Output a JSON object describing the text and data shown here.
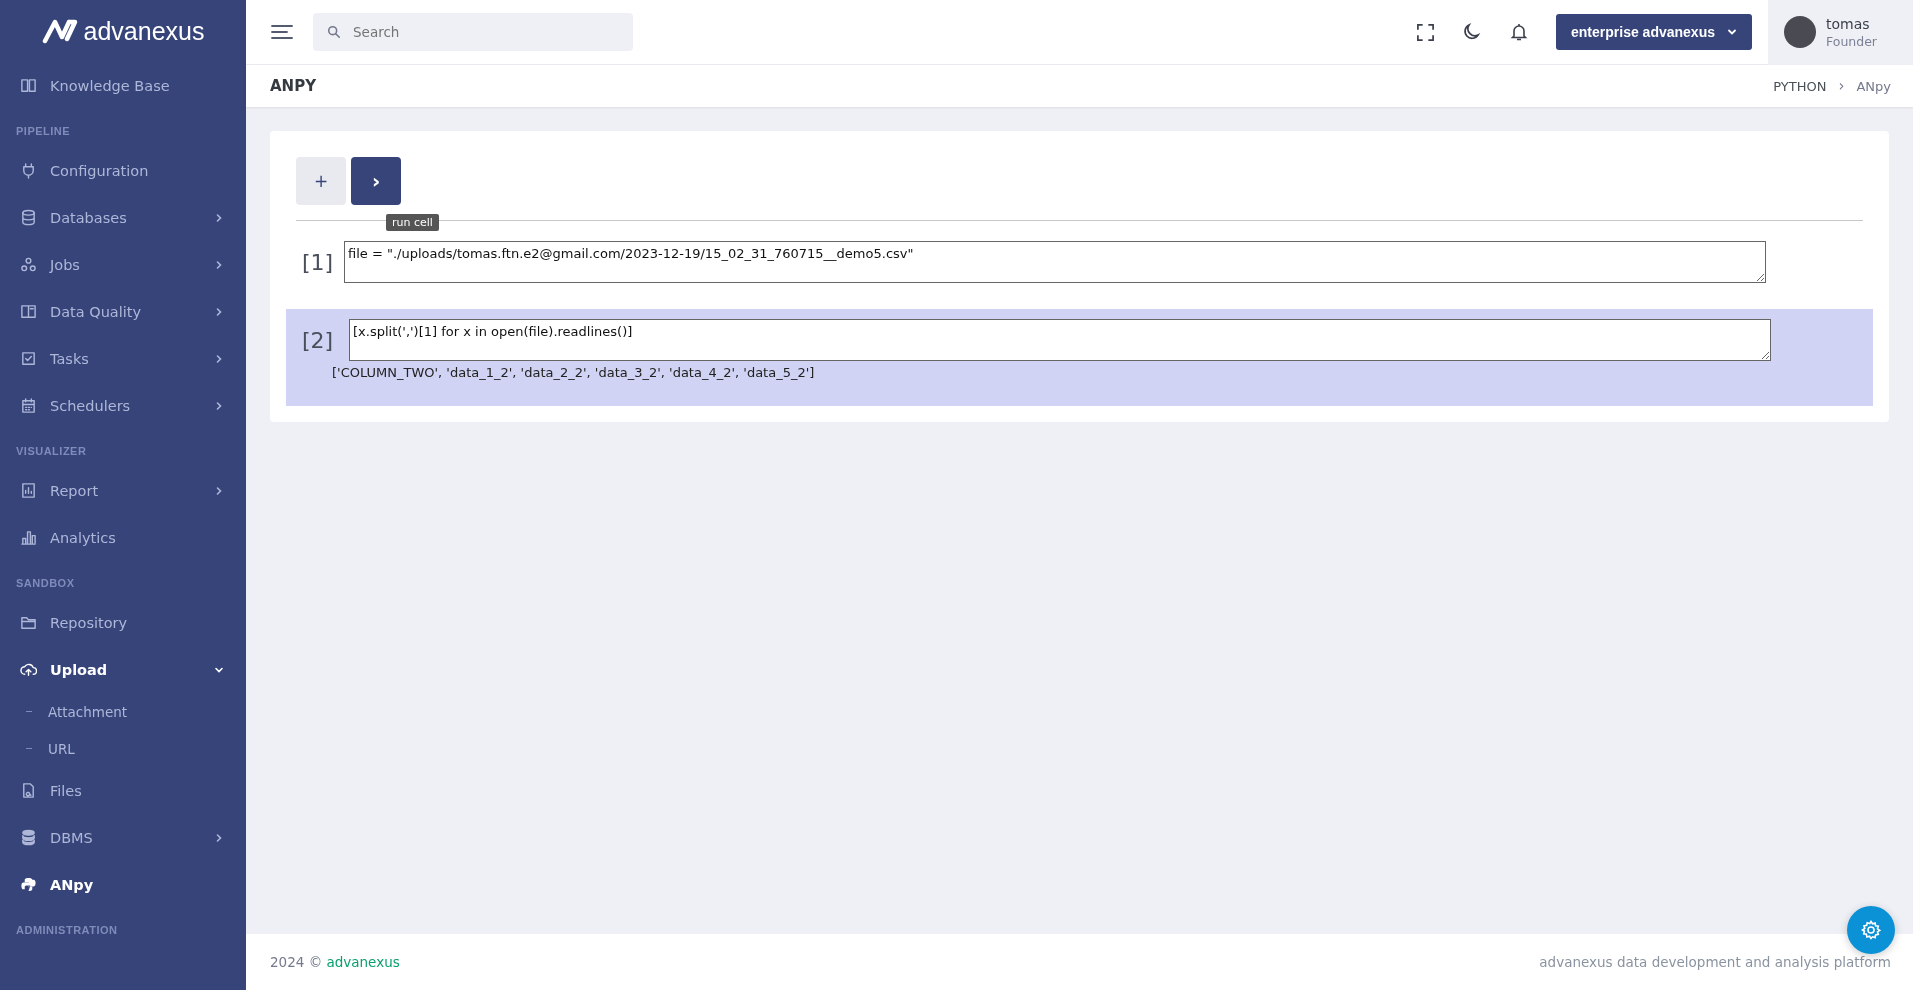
{
  "brand": {
    "name": "advanexus"
  },
  "sidebar": {
    "sections": [
      {
        "items": [
          {
            "label": "Knowledge Base",
            "selected": false
          }
        ]
      },
      {
        "heading": "PIPELINE",
        "items": [
          {
            "label": "Configuration",
            "selected": false
          },
          {
            "label": "Databases",
            "selected": false,
            "expanded": false
          },
          {
            "label": "Jobs",
            "selected": false,
            "expanded": false
          },
          {
            "label": "Data Quality",
            "selected": false,
            "expanded": false
          },
          {
            "label": "Tasks",
            "selected": false,
            "expanded": false
          },
          {
            "label": "Schedulers",
            "selected": false,
            "expanded": false
          }
        ]
      },
      {
        "heading": "VISUALIZER",
        "items": [
          {
            "label": "Report",
            "selected": false,
            "expanded": false
          },
          {
            "label": "Analytics",
            "selected": false
          }
        ]
      },
      {
        "heading": "SANDBOX",
        "items": [
          {
            "label": "Repository",
            "selected": false
          },
          {
            "label": "Upload",
            "selected": true,
            "expanded": true,
            "children": [
              {
                "label": "Attachment",
                "selected": false
              },
              {
                "label": "URL",
                "selected": false
              }
            ]
          },
          {
            "label": "Files",
            "selected": false
          },
          {
            "label": "DBMS",
            "selected": false,
            "expanded": false
          },
          {
            "label": "ANpy",
            "selected": true
          }
        ]
      },
      {
        "heading": "ADMINISTRATION"
      }
    ]
  },
  "header": {
    "search": {
      "placeholder": "Search"
    },
    "workspace": "enterprise advanexus",
    "user": {
      "name": "tomas",
      "role": "Founder"
    }
  },
  "page": {
    "title": "ANPY",
    "breadcrumb": [
      {
        "label": "PYTHON",
        "current": false
      },
      {
        "label": "ANpy",
        "current": true
      }
    ],
    "separator": "›"
  },
  "notebook": {
    "toolbar": [
      {
        "label": "+",
        "kind": "add"
      },
      {
        "label": "›",
        "kind": "run",
        "tooltip": "run cell"
      }
    ],
    "cells": [
      {
        "number": "[1]",
        "code": "file = \"./uploads/tomas.ftn.e2@gmail.com/2023-12-19/15_02_31_760715__demo5.csv\"",
        "selected": false
      },
      {
        "number": "[2]",
        "code": "[x.split(',')[1] for x in open(file).readlines()]",
        "output": "['COLUMN_TWO', 'data_1_2', 'data_2_2', 'data_3_2', 'data_4_2', 'data_5_2']",
        "selected": true
      }
    ]
  },
  "footer": {
    "copyright": "2024 ©",
    "link": "advanexus",
    "tagline": "advanexus data development and analysis platform"
  }
}
